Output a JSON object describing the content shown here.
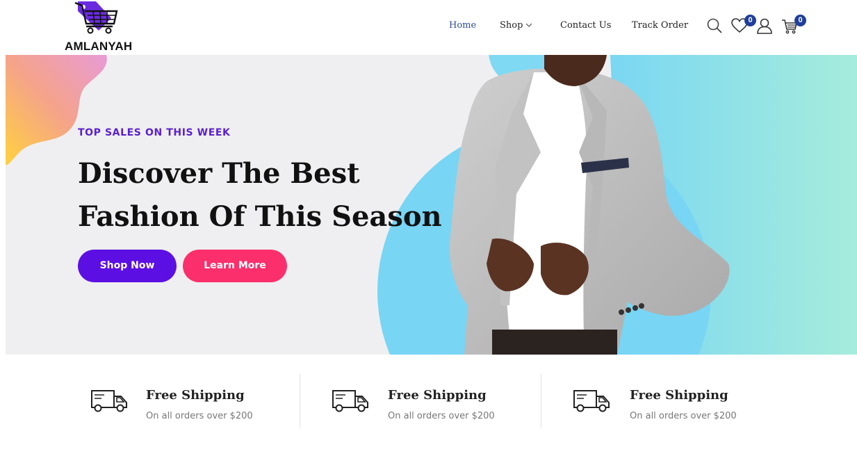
{
  "brand": {
    "name": "AMLANYAH",
    "logo_icon": "shopping-cart-tag-icon",
    "accent": "#6a2be0"
  },
  "nav": {
    "items": [
      {
        "label": "Home",
        "active": true
      },
      {
        "label": "Shop",
        "has_dropdown": true
      },
      {
        "label": "Contact Us"
      },
      {
        "label": "Track Order"
      }
    ],
    "active_color": "#2d4e93"
  },
  "header_icons": {
    "search": "search-icon",
    "wishlist": {
      "icon": "heart-icon",
      "count": "0"
    },
    "account": "user-icon",
    "cart": {
      "icon": "cart-icon",
      "count": "0"
    }
  },
  "hero": {
    "kicker": "TOP SALES ON THIS WEEK",
    "title_line1": "Discover The Best",
    "title_line2": "Fashion Of This Season",
    "primary_button": "Shop Now",
    "secondary_button": "Learn More",
    "colors": {
      "primary": "#5c0fe3",
      "secondary": "#fb2f6b",
      "kicker": "#5a1fd1"
    }
  },
  "features": [
    {
      "icon": "delivery-truck-icon",
      "title": "Free Shipping",
      "subtitle": "On all orders over $200"
    },
    {
      "icon": "delivery-truck-icon",
      "title": "Free Shipping",
      "subtitle": "On all orders over $200"
    },
    {
      "icon": "delivery-truck-icon",
      "title": "Free Shipping",
      "subtitle": "On all orders over $200"
    }
  ]
}
